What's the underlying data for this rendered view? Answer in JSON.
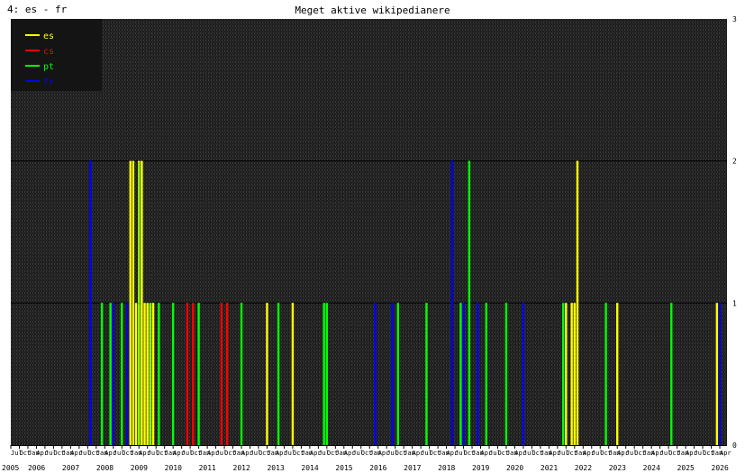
{
  "window": {
    "corner_label": "4: es - fr"
  },
  "chart_data": {
    "type": "bar",
    "title": "Meget aktive wikipedianere",
    "xlabel": "",
    "ylabel": "",
    "ylim": [
      0,
      3
    ],
    "y_ticks": [
      "0",
      "1",
      "2",
      "3"
    ],
    "grid": true,
    "legend_position": "top-left",
    "x_range": [
      "2005-07",
      "2026-04"
    ],
    "month_tick_labels": [
      "Jul",
      "Oct",
      "Jan",
      "Apr"
    ],
    "year_labels": [
      "2005",
      "2006",
      "2007",
      "2008",
      "2009",
      "2010",
      "2011",
      "2012",
      "2013",
      "2014",
      "2015",
      "2016",
      "2017",
      "2018",
      "2019",
      "2020",
      "2021",
      "2022",
      "2023",
      "2024",
      "2025",
      "2026"
    ],
    "series": [
      {
        "name": "es",
        "color": "#ffff00",
        "points": [
          [
            "2009-01",
            2
          ],
          [
            "2009-02",
            2
          ],
          [
            "2009-03",
            1
          ],
          [
            "2009-04",
            2
          ],
          [
            "2009-05",
            2
          ],
          [
            "2009-06",
            1
          ],
          [
            "2009-07",
            1
          ],
          [
            "2009-08",
            1
          ],
          [
            "2009-09",
            1
          ],
          [
            "2013-01",
            1
          ],
          [
            "2013-10",
            1
          ],
          [
            "2021-10",
            1
          ],
          [
            "2021-12",
            1
          ],
          [
            "2022-01",
            1
          ],
          [
            "2022-02",
            2
          ],
          [
            "2023-04",
            1
          ],
          [
            "2026-03",
            1
          ]
        ]
      },
      {
        "name": "cs",
        "color": "#ff0000",
        "points": [
          [
            "2010-09",
            1
          ],
          [
            "2010-11",
            1
          ],
          [
            "2011-09",
            1
          ],
          [
            "2011-11",
            1
          ]
        ]
      },
      {
        "name": "pt",
        "color": "#00ff00",
        "points": [
          [
            "2008-03",
            1
          ],
          [
            "2008-06",
            1
          ],
          [
            "2008-10",
            1
          ],
          [
            "2009-04",
            1
          ],
          [
            "2009-08",
            1
          ],
          [
            "2009-11",
            1
          ],
          [
            "2010-04",
            1
          ],
          [
            "2011-01",
            1
          ],
          [
            "2012-04",
            1
          ],
          [
            "2013-05",
            1
          ],
          [
            "2014-09",
            1
          ],
          [
            "2014-10",
            1
          ],
          [
            "2016-11",
            1
          ],
          [
            "2017-09",
            1
          ],
          [
            "2018-09",
            1
          ],
          [
            "2018-12",
            2
          ],
          [
            "2019-06",
            1
          ],
          [
            "2020-01",
            1
          ],
          [
            "2021-09",
            1
          ],
          [
            "2022-12",
            1
          ],
          [
            "2024-11",
            1
          ]
        ]
      },
      {
        "name": "fr",
        "color": "#0000ff",
        "points": [
          [
            "2007-11",
            2
          ],
          [
            "2008-07",
            1
          ],
          [
            "2008-12",
            1
          ],
          [
            "2016-03",
            1
          ],
          [
            "2016-09",
            1
          ],
          [
            "2018-06",
            2
          ],
          [
            "2018-10",
            1
          ],
          [
            "2019-03",
            1
          ],
          [
            "2020-07",
            1
          ],
          [
            "2026-04",
            1
          ]
        ]
      }
    ],
    "colors": {
      "background": "#1e1e1e",
      "hatch": "#303030",
      "gridline": "#000000",
      "pt_es_overlap": "#90ff00"
    }
  }
}
